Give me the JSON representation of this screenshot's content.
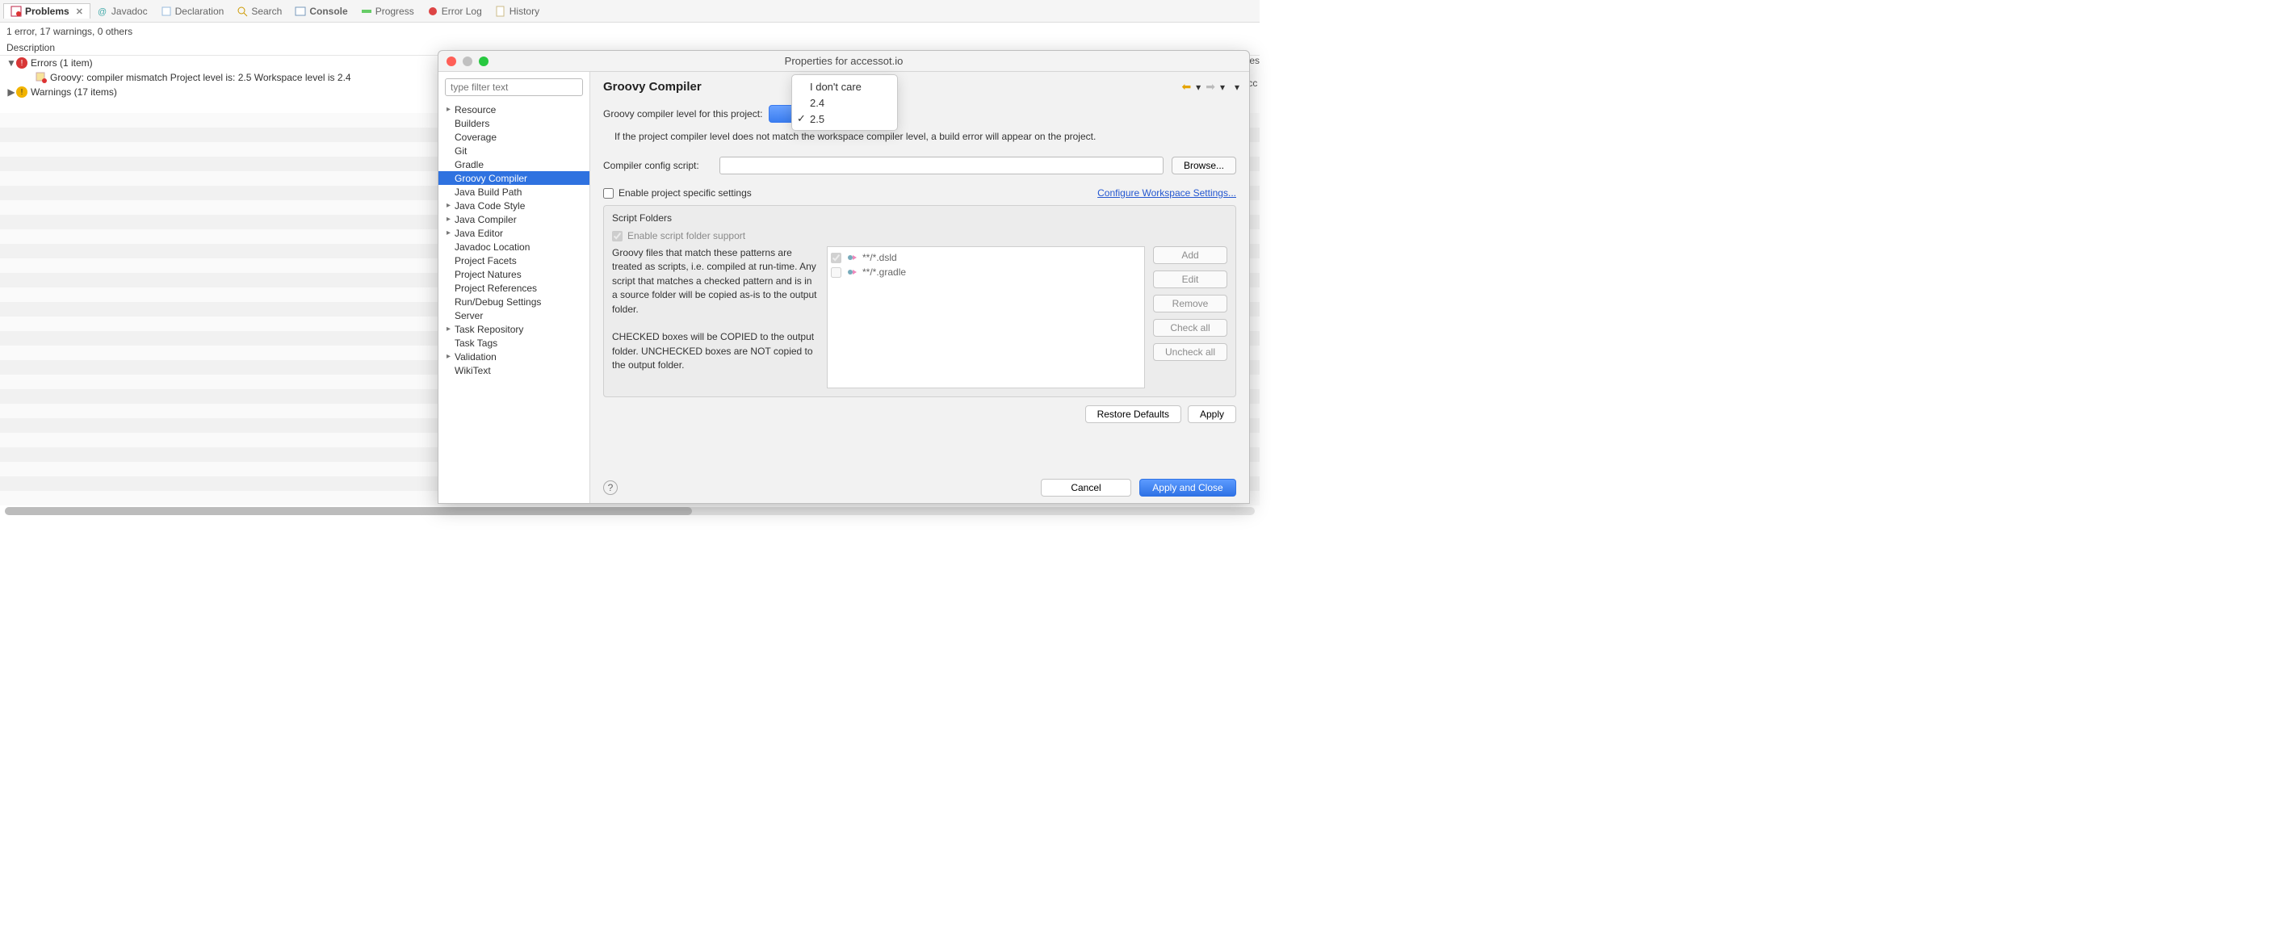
{
  "tabs": [
    {
      "label": "Problems",
      "active": true,
      "closable": true
    },
    {
      "label": "Javadoc"
    },
    {
      "label": "Declaration"
    },
    {
      "label": "Search"
    },
    {
      "label": "Console",
      "bold": true
    },
    {
      "label": "Progress"
    },
    {
      "label": "Error Log"
    },
    {
      "label": "History"
    }
  ],
  "summary": "1 error, 17 warnings, 0 others",
  "desc_header": "Description",
  "tree": {
    "errors_label": "Errors (1 item)",
    "error_item": "Groovy: compiler mismatch Project level is: 2.5 Workspace level is 2.4",
    "warnings_label": "Warnings (17 items)"
  },
  "truncated_right": "Res",
  "truncated_right2": "acc",
  "dialog": {
    "title": "Properties for accessot.io",
    "filter_placeholder": "type filter text",
    "nav": [
      {
        "label": "Resource",
        "exp": true
      },
      {
        "label": "Builders"
      },
      {
        "label": "Coverage"
      },
      {
        "label": "Git"
      },
      {
        "label": "Gradle"
      },
      {
        "label": "Groovy Compiler",
        "selected": true
      },
      {
        "label": "Java Build Path"
      },
      {
        "label": "Java Code Style",
        "exp": true
      },
      {
        "label": "Java Compiler",
        "exp": true
      },
      {
        "label": "Java Editor",
        "exp": true
      },
      {
        "label": "Javadoc Location"
      },
      {
        "label": "Project Facets"
      },
      {
        "label": "Project Natures"
      },
      {
        "label": "Project References"
      },
      {
        "label": "Run/Debug Settings"
      },
      {
        "label": "Server"
      },
      {
        "label": "Task Repository",
        "exp": true
      },
      {
        "label": "Task Tags"
      },
      {
        "label": "Validation",
        "exp": true
      },
      {
        "label": "WikiText"
      }
    ],
    "page_title": "Groovy Compiler",
    "level_label": "Groovy compiler level for this project:",
    "level_options": [
      "I don't care",
      "2.4",
      "2.5"
    ],
    "level_selected": "2.5",
    "mismatch_note": "If the project compiler level does not match the workspace compiler level, a build error will appear on the project.",
    "config_label": "Compiler config script:",
    "browse": "Browse...",
    "enable_specific": "Enable project specific settings",
    "workspace_link": "Configure Workspace Settings...",
    "group_title": "Script Folders",
    "enable_script_support": "Enable script folder support",
    "para1": "Groovy files that match these patterns are treated as scripts, i.e. compiled at run-time. Any script that matches a checked pattern and is in a source folder will be copied as-is to the output folder.",
    "para2": "CHECKED boxes will be COPIED to the output folder.  UNCHECKED boxes are NOT copied to the output folder.",
    "patterns": [
      {
        "label": "**/*.dsld",
        "checked": true
      },
      {
        "label": "**/*.gradle",
        "checked": false
      }
    ],
    "btn_add": "Add",
    "btn_edit": "Edit",
    "btn_remove": "Remove",
    "btn_checkall": "Check all",
    "btn_uncheckall": "Uncheck all",
    "restore": "Restore Defaults",
    "apply": "Apply",
    "cancel": "Cancel",
    "apply_close": "Apply and Close"
  }
}
